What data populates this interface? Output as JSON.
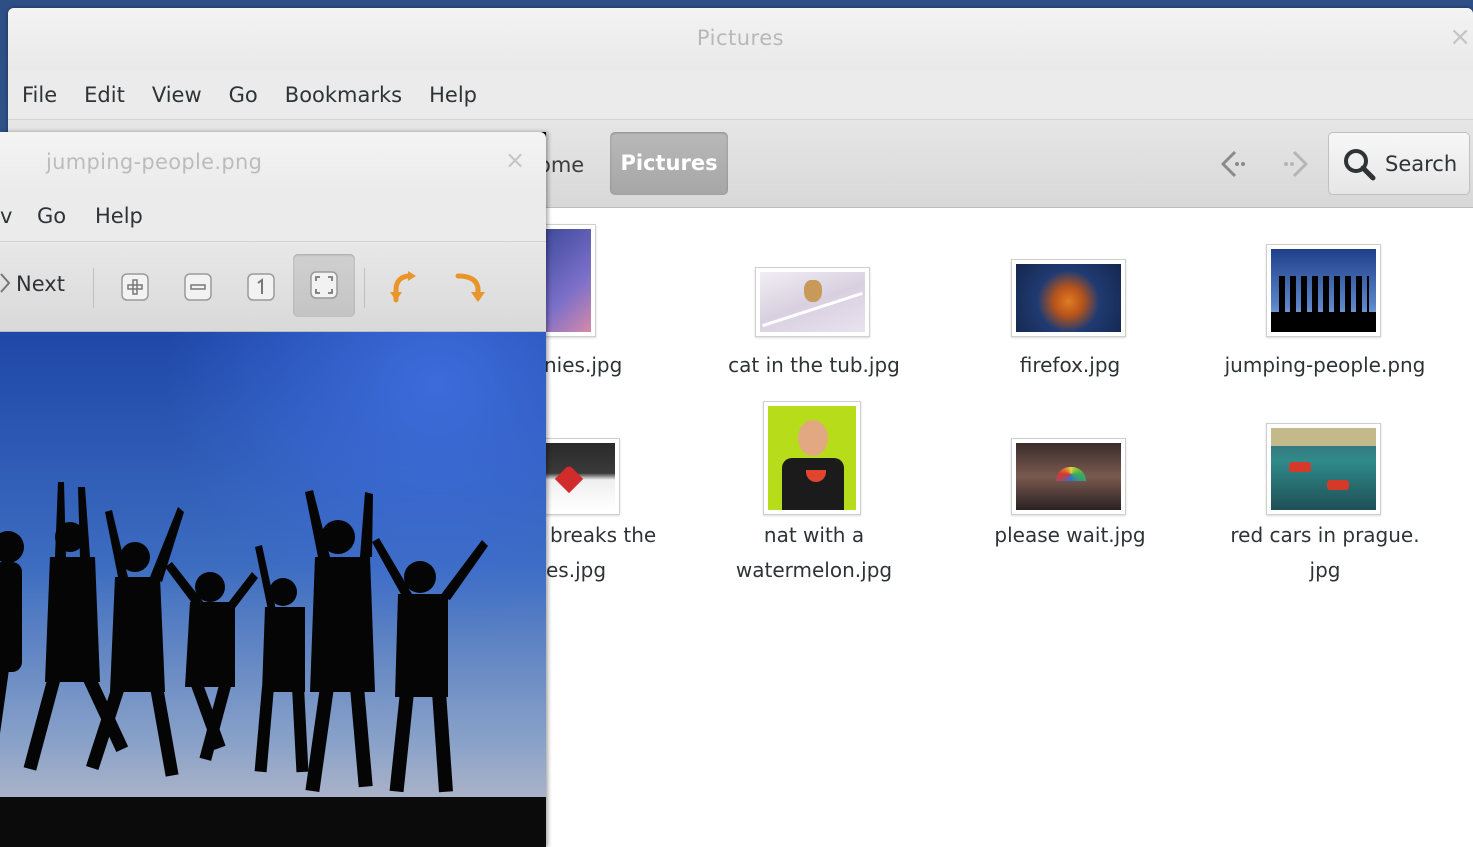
{
  "file_manager": {
    "title": "Pictures",
    "close_glyph": "×",
    "menu": [
      "File",
      "Edit",
      "View",
      "Go",
      "Bookmarks",
      "Help"
    ],
    "breadcrumb": {
      "home_partial": "ome",
      "current": "Pictures"
    },
    "search_label": "Search",
    "icons": {
      "back": "back-arrow-icon",
      "forward": "forward-arrow-icon",
      "search": "magnifier-icon"
    },
    "files": [
      {
        "name": "nies.jpg"
      },
      {
        "name": "cat in the tub.jpg"
      },
      {
        "name": "firefox.jpg"
      },
      {
        "name": "jumping-people.png"
      },
      {
        "name_line1": "breaks the",
        "name_line2": "es.jpg"
      },
      {
        "name_line1": "nat with a",
        "name_line2": "watermelon.jpg"
      },
      {
        "name": "please wait.jpg"
      },
      {
        "name_line1": "red cars in prague.",
        "name_line2": "jpg"
      }
    ]
  },
  "viewer": {
    "title": "jumping-people.png",
    "close_glyph": "×",
    "menu": {
      "partial": "v",
      "go": "Go",
      "help": "Help"
    },
    "next_label": "Next",
    "toolbar_icons": [
      "zoom-in-icon",
      "zoom-out-icon",
      "normal-size-icon",
      "best-fit-icon",
      "rotate-left-icon",
      "rotate-right-icon"
    ]
  },
  "colors": {
    "accent_orange": "#f0a030",
    "selected_crumb": "#a9a9a9",
    "desktop_blue": "#3b62a0"
  }
}
